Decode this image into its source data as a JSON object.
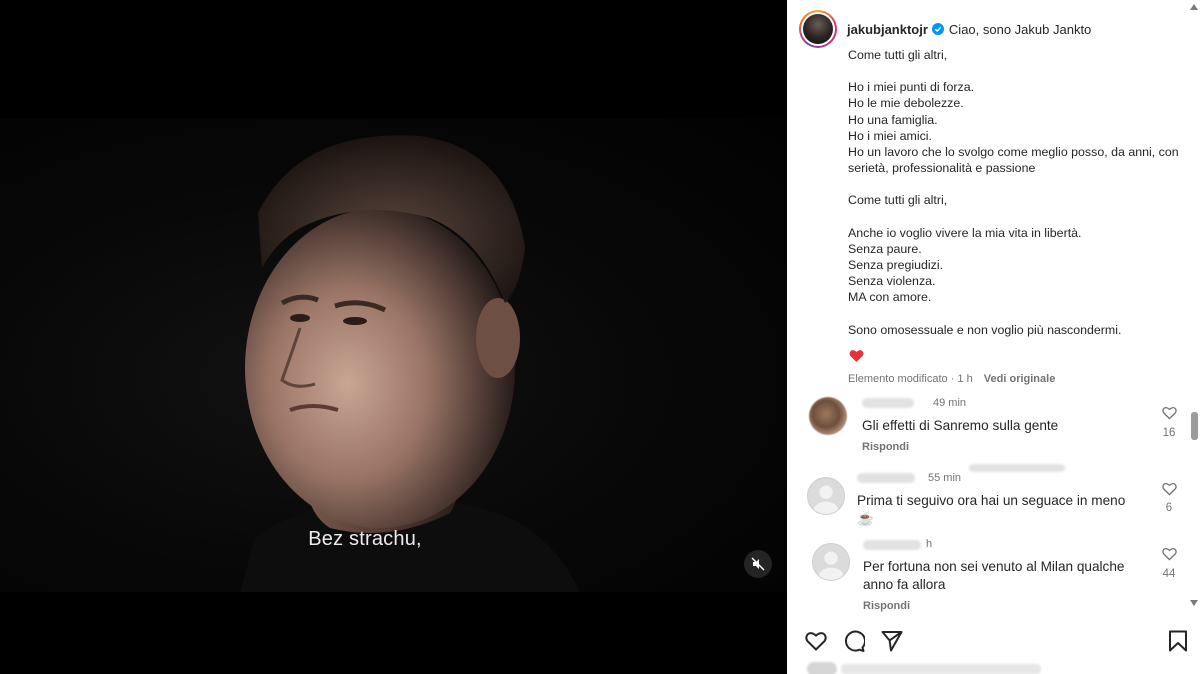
{
  "video": {
    "subtitle": "Bez strachu,",
    "mute_icon": "speaker-muted-icon"
  },
  "post": {
    "author": "jakubjanktojr",
    "verified_icon": "verified-badge-icon",
    "caption_first_line": "Ciao, sono Jakub Jankto",
    "caption_paragraphs": [
      "Come tutti gli altri,",
      "Ho i miei punti di forza.\nHo le mie debolezze.\nHo una famiglia.\nHo i miei amici.\nHo un lavoro che lo svolgo come meglio posso, da anni, con serietà, professionalità e passione",
      "Come tutti gli altri,",
      "Anche io voglio vivere la mia vita in libertà.\nSenza paure.\nSenza pregiudizi.\nSenza violenza.\nMA con amore.",
      "Sono omosessuale e non voglio più nascondermi."
    ],
    "heart_emoji": "❤️",
    "meta": {
      "edited": "Elemento modificato · 1 h",
      "see_original": "Vedi originale"
    },
    "accent_color": "#0095f6"
  },
  "comments": [
    {
      "time": "49 min",
      "text": "Gli effetti di Sanremo sulla gente",
      "reply": "Rispondi",
      "likes": "16"
    },
    {
      "time": "55 min",
      "text": "Prima ti seguivo ora hai un seguace in meno\n☕",
      "reply": "",
      "likes": "6"
    },
    {
      "time": "h",
      "text": "Per fortuna non sei venuto al Milan qualche anno fa allora",
      "reply": "Rispondi",
      "likes": "44"
    }
  ],
  "actions": {
    "like_icon": "heart-outline-icon",
    "comment_icon": "comment-icon",
    "share_icon": "paper-plane-icon",
    "save_icon": "bookmark-icon"
  }
}
